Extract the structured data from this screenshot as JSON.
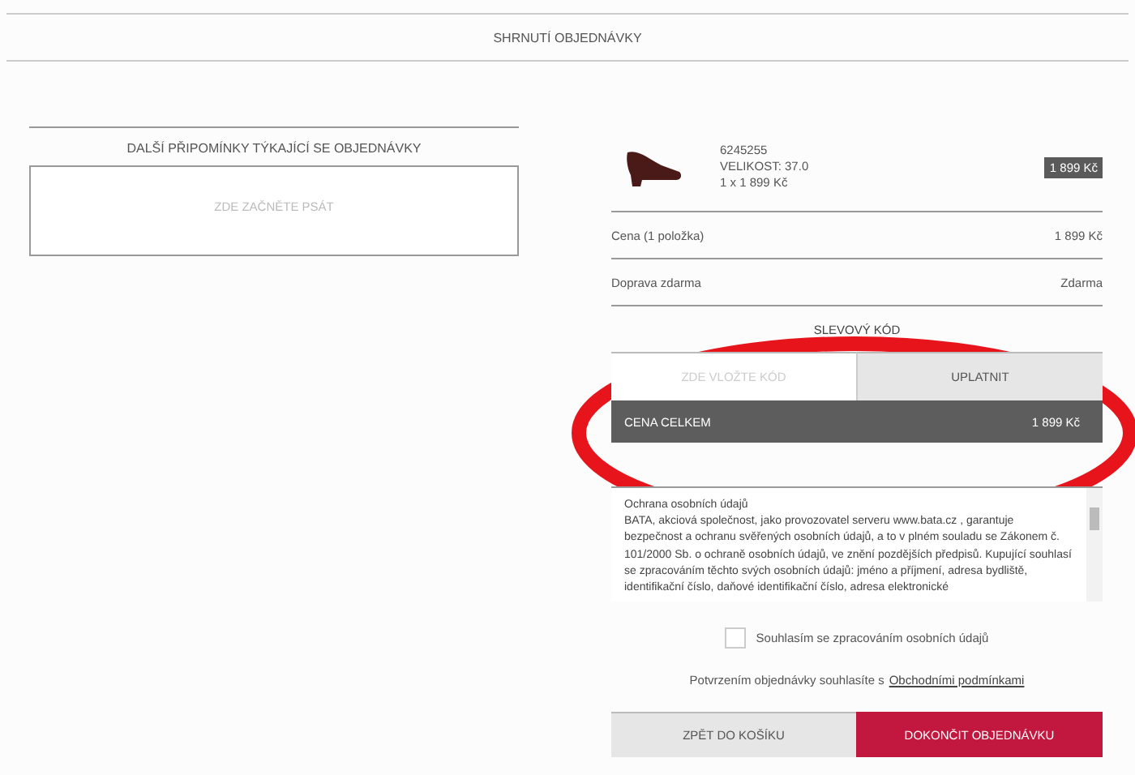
{
  "header": {
    "title": "SHRNUTÍ OBJEDNÁVKY"
  },
  "notes": {
    "title": "DALŠÍ PŘIPOMÍNKY TÝKAJÍCÍ SE OBJEDNÁVKY",
    "placeholder": "ZDE ZAČNĚTE PSÁT"
  },
  "product": {
    "code": "6245255",
    "size": "VELIKOST: 37.0",
    "quantity": "1 x 1 899 Kč",
    "price": "1 899 Kč"
  },
  "summary": [
    {
      "label": "Cena (1 položka)",
      "value": "1 899 Kč"
    },
    {
      "label": "Doprava zdarma",
      "value": "Zdarma"
    }
  ],
  "discount": {
    "title": "SLEVOVÝ KÓD",
    "placeholder": "ZDE VLOŽTE KÓD",
    "button": "UPLATNIT"
  },
  "total": {
    "label": "CENA CELKEM",
    "value": "1 899 Kč"
  },
  "privacy": {
    "heading": "Ochrana osobních údajů",
    "text": "BATA, akciová společnost, jako provozovatel serveru www.bata.cz , garantuje bezpečnost a ochranu svěřených osobních údajů, a to v plném souladu se Zákonem č. 101/2000 Sb. o ochraně osobních údajů, ve znění pozdějších předpisů. Kupující souhlasí se zpracováním těchto svých osobních údajů: jméno a příjmení, adresa bydliště, identifikační číslo, daňové identifikační číslo, adresa elektronické"
  },
  "consent": {
    "label": "Souhlasím se zpracováním osobních údajů",
    "checked": false
  },
  "terms": {
    "text": "Potvrzením objednávky souhlasíte s",
    "link": "Obchodními podmínkami"
  },
  "buttons": {
    "back": "ZPĚT DO KOŠÍKU",
    "finish": "DOKONČIT OBJEDNÁVKU"
  }
}
